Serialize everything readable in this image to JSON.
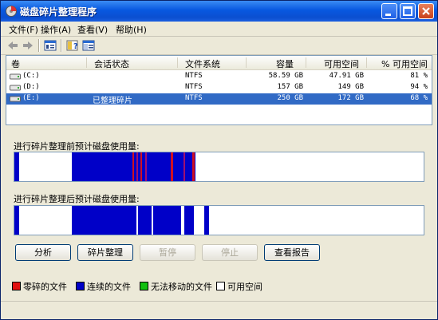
{
  "window": {
    "title": "磁盘碎片整理程序"
  },
  "menu": [
    {
      "label": "文件(F)"
    },
    {
      "label": "操作(A)"
    },
    {
      "label": "查看(V)"
    },
    {
      "label": "帮助(H)"
    }
  ],
  "toolbar": {
    "icons": [
      "back-arrow-icon",
      "forward-arrow-icon",
      "volume-properties-icon",
      "help-icon",
      "console-tree-icon"
    ]
  },
  "columns": [
    "卷",
    "会话状态",
    "文件系统",
    "容量",
    "可用空间",
    "% 可用空间"
  ],
  "volumes": [
    {
      "name": "(C:)",
      "status": "",
      "fs": "NTFS",
      "capacity": "58.59 GB",
      "free": "47.91 GB",
      "pct": "81 %"
    },
    {
      "name": "(D:)",
      "status": "",
      "fs": "NTFS",
      "capacity": "157 GB",
      "free": "149 GB",
      "pct": "94 %"
    },
    {
      "name": "(E:)",
      "status": "已整理碎片",
      "fs": "NTFS",
      "capacity": "250 GB",
      "free": "172 GB",
      "pct": "68 %",
      "selected": true
    }
  ],
  "gauges": {
    "before_label": "进行碎片整理前预计磁盘使用量:",
    "after_label": "进行碎片整理后预计磁盘使用量:"
  },
  "buttons": {
    "analyze": "分析",
    "defragment": "碎片整理",
    "pause": "暂停",
    "stop": "停止",
    "report": "查看报告"
  },
  "legend": [
    {
      "label": "零碎的文件",
      "color": "#e01010"
    },
    {
      "label": "连续的文件",
      "color": "#0000c8"
    },
    {
      "label": "无法移动的文件",
      "color": "#10c010"
    },
    {
      "label": "可用空间",
      "color": "#ffffff"
    }
  ],
  "colors": {
    "fragmented": "#e01010",
    "contiguous": "#0000c8",
    "free": "#ffffff",
    "selection": "#316ac5",
    "titlebar": "#0858e0"
  }
}
